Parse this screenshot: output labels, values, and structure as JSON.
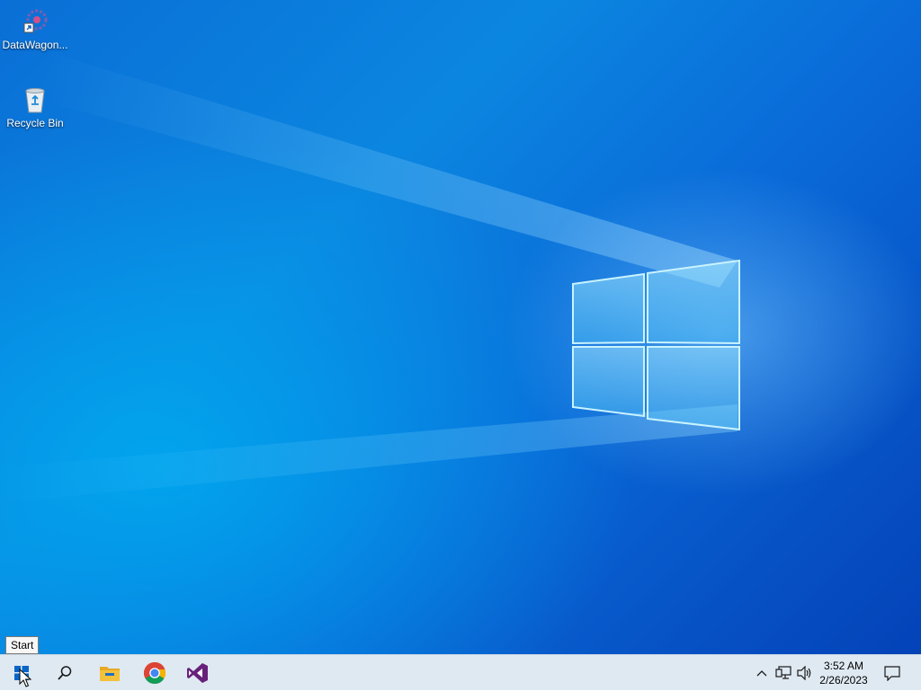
{
  "desktop": {
    "icons": [
      {
        "label": "DataWagon...",
        "icon": "datawagon-app-icon"
      },
      {
        "label": "Recycle Bin",
        "icon": "recycle-bin-icon"
      }
    ],
    "wallpaper": {
      "accent": "#0a78d8",
      "logo": "windows-logo"
    }
  },
  "tooltip": {
    "text": "Start"
  },
  "taskbar": {
    "buttons": [
      {
        "name": "Start",
        "icon": "windows-start-icon"
      },
      {
        "name": "Search",
        "icon": "search-icon"
      },
      {
        "name": "File Explorer",
        "icon": "folder-icon"
      },
      {
        "name": "Google Chrome",
        "icon": "chrome-icon"
      },
      {
        "name": "Visual Studio",
        "icon": "visual-studio-icon"
      }
    ],
    "tray": {
      "icons": [
        "chevron-up-icon",
        "network-icon",
        "volume-icon"
      ],
      "clock": {
        "time": "3:52 AM",
        "date": "2/26/2023"
      },
      "notification_icon": "action-center-icon"
    }
  },
  "colors": {
    "taskbar_bg": "#dee8f0",
    "vs_purple": "#68217a",
    "folder_yellow": "#f3c13a"
  }
}
